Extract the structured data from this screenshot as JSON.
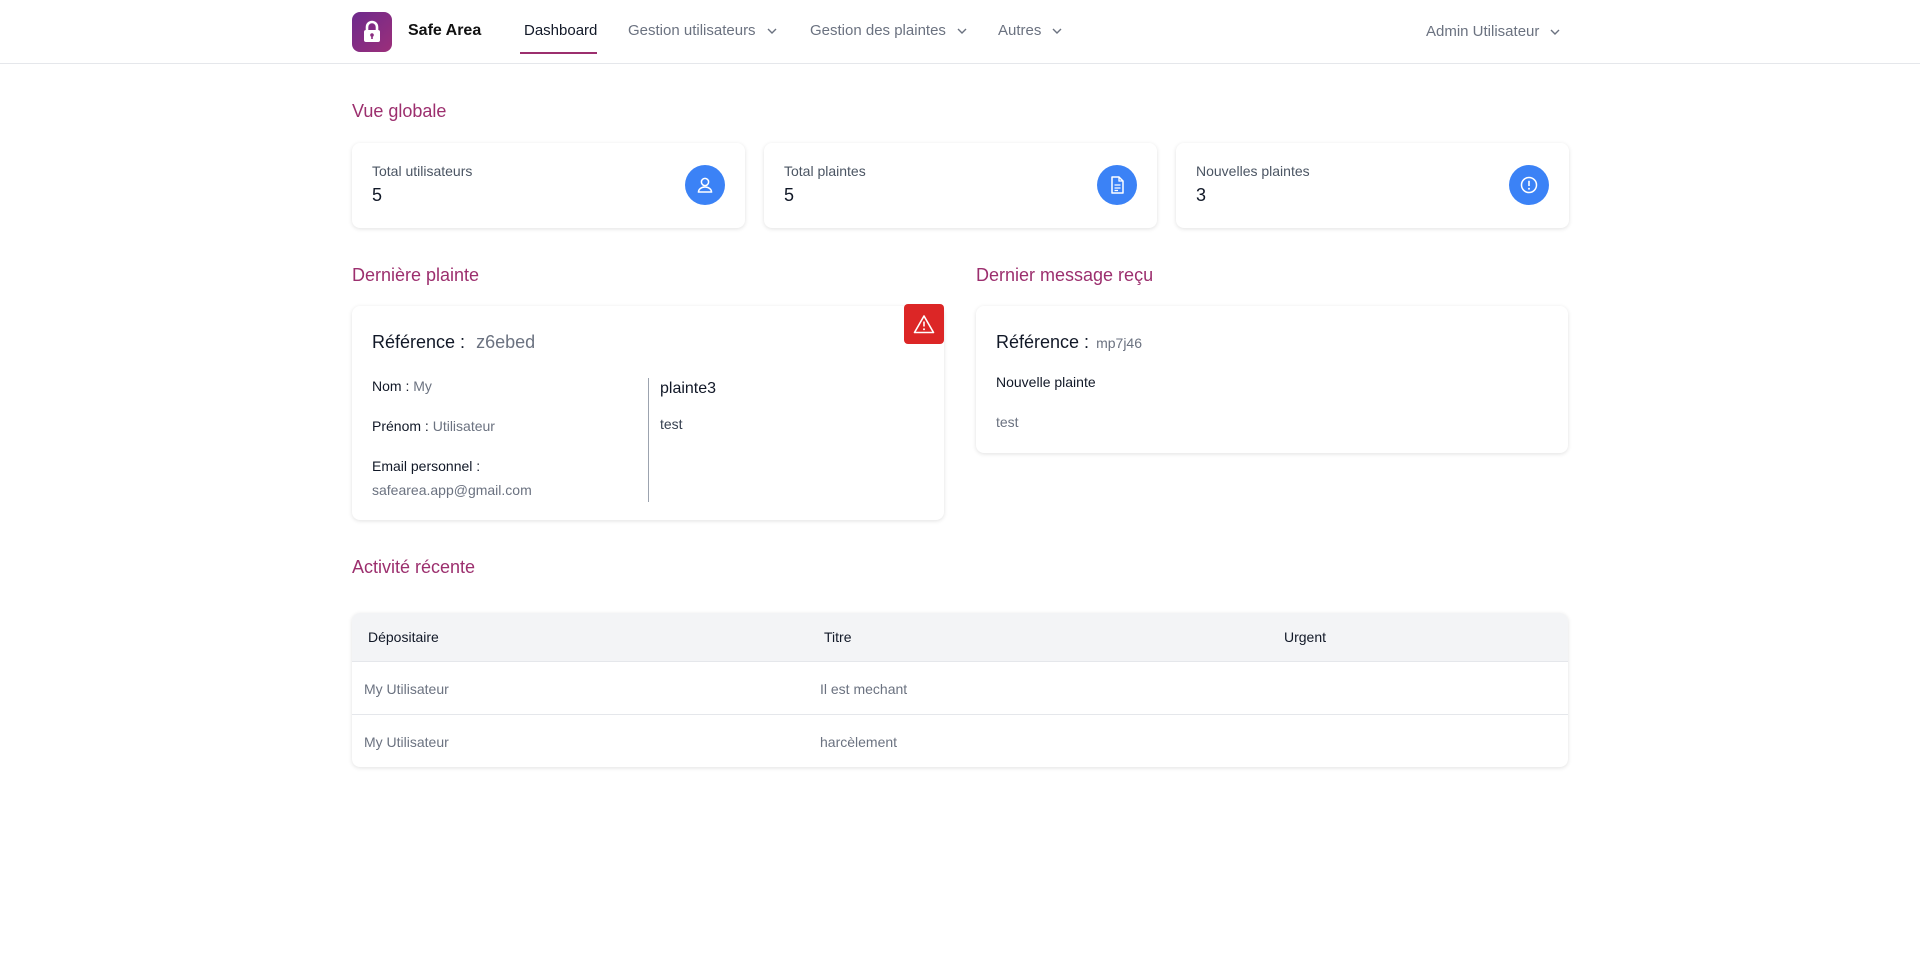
{
  "header": {
    "brand": "Safe Area",
    "nav": [
      {
        "label": "Dashboard"
      },
      {
        "label": "Gestion utilisateurs"
      },
      {
        "label": "Gestion des plaintes"
      },
      {
        "label": "Autres"
      }
    ],
    "user": "Admin Utilisateur"
  },
  "overview": {
    "title": "Vue globale",
    "stats": [
      {
        "label": "Total utilisateurs",
        "value": "5",
        "icon": "user-icon"
      },
      {
        "label": "Total plaintes",
        "value": "5",
        "icon": "document-icon"
      },
      {
        "label": "Nouvelles plaintes",
        "value": "3",
        "icon": "alert-circle-icon"
      }
    ]
  },
  "last_complaint": {
    "title": "Dernière plainte",
    "ref_label": "Référence :",
    "ref_value": "z6ebed",
    "nom_label": "Nom :",
    "nom_value": "My",
    "prenom_label": "Prénom :",
    "prenom_value": "Utilisateur",
    "email_label": "Email personnel :",
    "email_value": "safearea.app@gmail.com",
    "complaint_title": "plainte3",
    "complaint_body": "test"
  },
  "last_message": {
    "title": "Dernier message reçu",
    "ref_label": "Référence :",
    "ref_value": "mp7j46",
    "subject": "Nouvelle plainte",
    "body": "test"
  },
  "activity": {
    "title": "Activité récente",
    "columns": [
      "Dépositaire",
      "Titre",
      "Urgent"
    ],
    "rows": [
      {
        "depositaire": "My Utilisateur",
        "titre": "Il est mechant",
        "urgent": ""
      },
      {
        "depositaire": "My Utilisateur",
        "titre": "harcèlement",
        "urgent": ""
      }
    ]
  },
  "colors": {
    "accent": "#9c2f6e",
    "stat_icon_bg": "#3b82f6",
    "alert": "#dc2626"
  }
}
